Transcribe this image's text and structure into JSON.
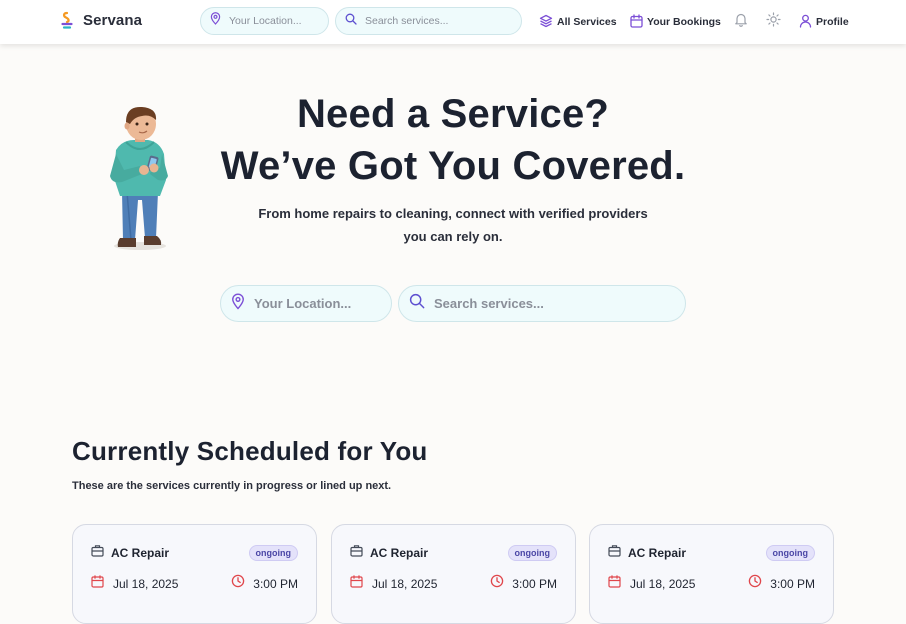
{
  "header": {
    "brand_name": "Servana",
    "location_placeholder": "Your Location...",
    "search_placeholder": "Search services...",
    "nav": {
      "all_services": "All Services",
      "your_bookings": "Your Bookings",
      "profile": "Profile"
    }
  },
  "hero": {
    "title_line1": "Need a Service?",
    "title_line2": "We’ve Got You Covered.",
    "subtitle_line1": "From home repairs to cleaning, connect with verified providers",
    "subtitle_line2": "you can rely on.",
    "location_placeholder": "Your Location...",
    "search_placeholder": "Search services..."
  },
  "scheduled": {
    "title": "Currently Scheduled for You",
    "subtitle": "These are the services currently in progress or lined up next.",
    "cards": [
      {
        "service": "AC Repair",
        "status": "ongoing",
        "date": "Jul 18, 2025",
        "time": "3:00 PM"
      },
      {
        "service": "AC Repair",
        "status": "ongoing",
        "date": "Jul 18, 2025",
        "time": "3:00 PM"
      },
      {
        "service": "AC Repair",
        "status": "ongoing",
        "date": "Jul 18, 2025",
        "time": "3:00 PM"
      }
    ]
  },
  "colors": {
    "accent_purple": "#7c4fd6",
    "calendar_red": "#e0464b",
    "input_bg": "#effbfc",
    "badge_bg": "#e4e2fa"
  },
  "icons": {
    "brand": "servana-logo-icon",
    "location": "map-pin-icon",
    "search": "search-icon",
    "all_services": "layers-icon",
    "bookings": "calendar-icon",
    "notifications": "bell-icon",
    "theme": "sun-icon",
    "profile": "user-icon",
    "card_service": "briefcase-icon",
    "card_date": "calendar-icon",
    "card_time": "clock-icon"
  }
}
